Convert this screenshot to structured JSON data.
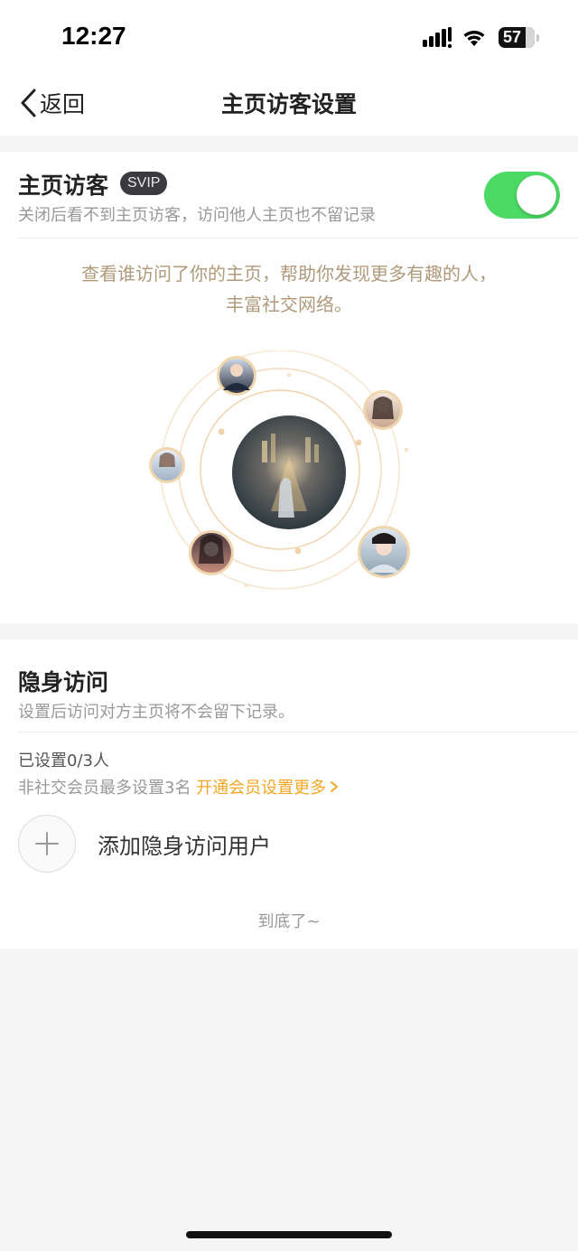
{
  "status_bar": {
    "time": "12:27",
    "battery": "57",
    "icons": [
      "signal-icon",
      "wifi-icon",
      "battery-icon"
    ]
  },
  "nav": {
    "back_label": "返回",
    "title": "主页访客设置"
  },
  "visitor": {
    "title": "主页访客",
    "badge": "SVIP",
    "description": "关闭后看不到主页访客，访问他人主页也不留记录",
    "toggle_on": true,
    "promo_line1": "查看谁访问了你的主页，帮助你发现更多有趣的人，",
    "promo_line2": "丰富社交网络。"
  },
  "incognito": {
    "title": "隐身访问",
    "description": "设置后访问对方主页将不会留下记录。",
    "set_count": "已设置0/3人",
    "limit_text": "非社交会员最多设置3名",
    "upgrade_link": "开通会员设置更多",
    "add_user_label": "添加隐身访问用户",
    "end_text": "到底了~"
  },
  "colors": {
    "accent_orange": "#f5a623",
    "toggle_green": "#4cd964",
    "promo_gold": "#b09a7c",
    "svip_badge_bg": "#3b3b3f"
  }
}
